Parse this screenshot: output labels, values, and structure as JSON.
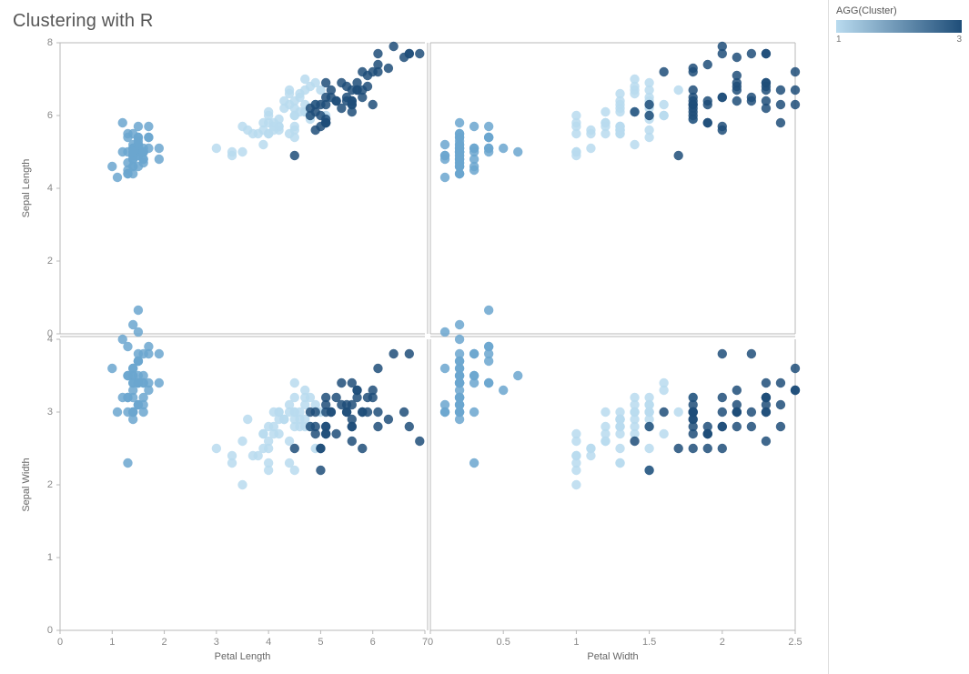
{
  "title": "Clustering with R",
  "legend": {
    "title": "AGG(Cluster)",
    "min": "1",
    "max": "3"
  },
  "chart_data": {
    "type": "scatter",
    "layout": "2x2 small multiples",
    "x_axes": [
      {
        "label": "Petal Length",
        "range": [
          0,
          7
        ],
        "ticks": [
          0,
          1,
          2,
          3,
          4,
          5,
          6,
          7
        ]
      },
      {
        "label": "Petal Width",
        "range": [
          0,
          2.5
        ],
        "ticks": [
          0.0,
          0.5,
          1.0,
          1.5,
          2.0,
          2.5
        ]
      }
    ],
    "y_axes": [
      {
        "label": "Sepal Length",
        "range": [
          0,
          8
        ],
        "ticks": [
          0,
          2,
          4,
          6,
          8
        ]
      },
      {
        "label": "Sepal Width",
        "range": [
          0,
          4
        ],
        "ticks": [
          0,
          1,
          2,
          3,
          4
        ]
      }
    ],
    "color": {
      "field": "cluster",
      "domain": [
        1,
        2,
        3
      ],
      "range": [
        "#6ba6cf",
        "#b9dbef",
        "#1f4e79"
      ]
    },
    "points": [
      {
        "pl": 1.4,
        "pw": 0.2,
        "sl": 5.1,
        "sw": 3.5,
        "c": 1
      },
      {
        "pl": 1.4,
        "pw": 0.2,
        "sl": 4.9,
        "sw": 3.0,
        "c": 1
      },
      {
        "pl": 1.3,
        "pw": 0.2,
        "sl": 4.7,
        "sw": 3.2,
        "c": 1
      },
      {
        "pl": 1.5,
        "pw": 0.2,
        "sl": 4.6,
        "sw": 3.1,
        "c": 1
      },
      {
        "pl": 1.4,
        "pw": 0.2,
        "sl": 5.0,
        "sw": 3.6,
        "c": 1
      },
      {
        "pl": 1.7,
        "pw": 0.4,
        "sl": 5.4,
        "sw": 3.9,
        "c": 1
      },
      {
        "pl": 1.4,
        "pw": 0.3,
        "sl": 4.6,
        "sw": 3.4,
        "c": 1
      },
      {
        "pl": 1.5,
        "pw": 0.2,
        "sl": 5.0,
        "sw": 3.4,
        "c": 1
      },
      {
        "pl": 1.4,
        "pw": 0.2,
        "sl": 4.4,
        "sw": 2.9,
        "c": 1
      },
      {
        "pl": 1.5,
        "pw": 0.1,
        "sl": 4.9,
        "sw": 3.1,
        "c": 1
      },
      {
        "pl": 1.5,
        "pw": 0.2,
        "sl": 5.4,
        "sw": 3.7,
        "c": 1
      },
      {
        "pl": 1.6,
        "pw": 0.2,
        "sl": 4.8,
        "sw": 3.4,
        "c": 1
      },
      {
        "pl": 1.4,
        "pw": 0.1,
        "sl": 4.8,
        "sw": 3.0,
        "c": 1
      },
      {
        "pl": 1.1,
        "pw": 0.1,
        "sl": 4.3,
        "sw": 3.0,
        "c": 1
      },
      {
        "pl": 1.2,
        "pw": 0.2,
        "sl": 5.8,
        "sw": 4.0,
        "c": 1
      },
      {
        "pl": 1.5,
        "pw": 0.4,
        "sl": 5.7,
        "sw": 4.4,
        "c": 1
      },
      {
        "pl": 1.3,
        "pw": 0.4,
        "sl": 5.4,
        "sw": 3.9,
        "c": 1
      },
      {
        "pl": 1.4,
        "pw": 0.3,
        "sl": 5.1,
        "sw": 3.5,
        "c": 1
      },
      {
        "pl": 1.7,
        "pw": 0.3,
        "sl": 5.7,
        "sw": 3.8,
        "c": 1
      },
      {
        "pl": 1.5,
        "pw": 0.3,
        "sl": 5.1,
        "sw": 3.8,
        "c": 1
      },
      {
        "pl": 1.7,
        "pw": 0.2,
        "sl": 5.4,
        "sw": 3.4,
        "c": 1
      },
      {
        "pl": 1.5,
        "pw": 0.4,
        "sl": 5.1,
        "sw": 3.7,
        "c": 1
      },
      {
        "pl": 1.0,
        "pw": 0.2,
        "sl": 4.6,
        "sw": 3.6,
        "c": 1
      },
      {
        "pl": 1.7,
        "pw": 0.5,
        "sl": 5.1,
        "sw": 3.3,
        "c": 1
      },
      {
        "pl": 1.9,
        "pw": 0.2,
        "sl": 4.8,
        "sw": 3.4,
        "c": 1
      },
      {
        "pl": 1.6,
        "pw": 0.2,
        "sl": 5.0,
        "sw": 3.0,
        "c": 1
      },
      {
        "pl": 1.6,
        "pw": 0.4,
        "sl": 5.0,
        "sw": 3.4,
        "c": 1
      },
      {
        "pl": 1.5,
        "pw": 0.2,
        "sl": 5.2,
        "sw": 3.5,
        "c": 1
      },
      {
        "pl": 1.4,
        "pw": 0.2,
        "sl": 5.2,
        "sw": 3.4,
        "c": 1
      },
      {
        "pl": 1.6,
        "pw": 0.2,
        "sl": 4.7,
        "sw": 3.2,
        "c": 1
      },
      {
        "pl": 1.6,
        "pw": 0.2,
        "sl": 4.8,
        "sw": 3.1,
        "c": 1
      },
      {
        "pl": 1.5,
        "pw": 0.4,
        "sl": 5.4,
        "sw": 3.4,
        "c": 1
      },
      {
        "pl": 1.5,
        "pw": 0.1,
        "sl": 5.2,
        "sw": 4.1,
        "c": 1
      },
      {
        "pl": 1.4,
        "pw": 0.2,
        "sl": 5.5,
        "sw": 4.2,
        "c": 1
      },
      {
        "pl": 1.5,
        "pw": 0.2,
        "sl": 4.9,
        "sw": 3.1,
        "c": 1
      },
      {
        "pl": 1.2,
        "pw": 0.2,
        "sl": 5.0,
        "sw": 3.2,
        "c": 1
      },
      {
        "pl": 1.3,
        "pw": 0.2,
        "sl": 5.5,
        "sw": 3.5,
        "c": 1
      },
      {
        "pl": 1.4,
        "pw": 0.1,
        "sl": 4.9,
        "sw": 3.6,
        "c": 1
      },
      {
        "pl": 1.3,
        "pw": 0.2,
        "sl": 4.4,
        "sw": 3.0,
        "c": 1
      },
      {
        "pl": 1.5,
        "pw": 0.2,
        "sl": 5.1,
        "sw": 3.4,
        "c": 1
      },
      {
        "pl": 1.3,
        "pw": 0.3,
        "sl": 5.0,
        "sw": 3.5,
        "c": 1
      },
      {
        "pl": 1.3,
        "pw": 0.3,
        "sl": 4.5,
        "sw": 2.3,
        "c": 1
      },
      {
        "pl": 1.3,
        "pw": 0.2,
        "sl": 4.4,
        "sw": 3.2,
        "c": 1
      },
      {
        "pl": 1.6,
        "pw": 0.6,
        "sl": 5.0,
        "sw": 3.5,
        "c": 1
      },
      {
        "pl": 1.9,
        "pw": 0.4,
        "sl": 5.1,
        "sw": 3.8,
        "c": 1
      },
      {
        "pl": 1.4,
        "pw": 0.3,
        "sl": 4.8,
        "sw": 3.0,
        "c": 1
      },
      {
        "pl": 1.6,
        "pw": 0.2,
        "sl": 5.1,
        "sw": 3.8,
        "c": 1
      },
      {
        "pl": 1.4,
        "pw": 0.2,
        "sl": 4.6,
        "sw": 3.2,
        "c": 1
      },
      {
        "pl": 1.5,
        "pw": 0.2,
        "sl": 5.3,
        "sw": 3.7,
        "c": 1
      },
      {
        "pl": 1.4,
        "pw": 0.2,
        "sl": 5.0,
        "sw": 3.3,
        "c": 1
      },
      {
        "pl": 4.7,
        "pw": 1.4,
        "sl": 7.0,
        "sw": 3.2,
        "c": 2
      },
      {
        "pl": 4.5,
        "pw": 1.5,
        "sl": 6.4,
        "sw": 3.2,
        "c": 2
      },
      {
        "pl": 4.9,
        "pw": 1.5,
        "sl": 6.9,
        "sw": 3.1,
        "c": 2
      },
      {
        "pl": 4.0,
        "pw": 1.3,
        "sl": 5.5,
        "sw": 2.3,
        "c": 2
      },
      {
        "pl": 4.6,
        "pw": 1.5,
        "sl": 6.5,
        "sw": 2.8,
        "c": 2
      },
      {
        "pl": 4.5,
        "pw": 1.3,
        "sl": 5.7,
        "sw": 2.8,
        "c": 2
      },
      {
        "pl": 4.7,
        "pw": 1.6,
        "sl": 6.3,
        "sw": 3.3,
        "c": 2
      },
      {
        "pl": 3.3,
        "pw": 1.0,
        "sl": 4.9,
        "sw": 2.4,
        "c": 2
      },
      {
        "pl": 4.6,
        "pw": 1.3,
        "sl": 6.6,
        "sw": 2.9,
        "c": 2
      },
      {
        "pl": 3.9,
        "pw": 1.4,
        "sl": 5.2,
        "sw": 2.7,
        "c": 2
      },
      {
        "pl": 3.5,
        "pw": 1.0,
        "sl": 5.0,
        "sw": 2.0,
        "c": 2
      },
      {
        "pl": 4.2,
        "pw": 1.5,
        "sl": 5.9,
        "sw": 3.0,
        "c": 2
      },
      {
        "pl": 4.0,
        "pw": 1.0,
        "sl": 6.0,
        "sw": 2.2,
        "c": 2
      },
      {
        "pl": 4.7,
        "pw": 1.4,
        "sl": 6.1,
        "sw": 2.9,
        "c": 2
      },
      {
        "pl": 3.6,
        "pw": 1.3,
        "sl": 5.6,
        "sw": 2.9,
        "c": 2
      },
      {
        "pl": 4.4,
        "pw": 1.4,
        "sl": 6.7,
        "sw": 3.1,
        "c": 2
      },
      {
        "pl": 4.5,
        "pw": 1.5,
        "sl": 5.6,
        "sw": 3.0,
        "c": 2
      },
      {
        "pl": 4.1,
        "pw": 1.0,
        "sl": 5.8,
        "sw": 2.7,
        "c": 2
      },
      {
        "pl": 4.5,
        "pw": 1.5,
        "sl": 6.2,
        "sw": 2.2,
        "c": 2
      },
      {
        "pl": 3.9,
        "pw": 1.1,
        "sl": 5.6,
        "sw": 2.5,
        "c": 2
      },
      {
        "pl": 4.8,
        "pw": 1.8,
        "sl": 5.9,
        "sw": 3.2,
        "c": 2
      },
      {
        "pl": 4.0,
        "pw": 1.3,
        "sl": 6.1,
        "sw": 2.8,
        "c": 2
      },
      {
        "pl": 4.9,
        "pw": 1.5,
        "sl": 6.3,
        "sw": 2.5,
        "c": 2
      },
      {
        "pl": 4.7,
        "pw": 1.2,
        "sl": 6.1,
        "sw": 2.8,
        "c": 2
      },
      {
        "pl": 4.3,
        "pw": 1.3,
        "sl": 6.4,
        "sw": 2.9,
        "c": 2
      },
      {
        "pl": 4.4,
        "pw": 1.4,
        "sl": 6.6,
        "sw": 3.0,
        "c": 2
      },
      {
        "pl": 4.8,
        "pw": 1.4,
        "sl": 6.8,
        "sw": 2.8,
        "c": 2
      },
      {
        "pl": 5.0,
        "pw": 1.7,
        "sl": 6.7,
        "sw": 3.0,
        "c": 2
      },
      {
        "pl": 4.5,
        "pw": 1.5,
        "sl": 6.0,
        "sw": 2.9,
        "c": 2
      },
      {
        "pl": 3.5,
        "pw": 1.0,
        "sl": 5.7,
        "sw": 2.6,
        "c": 2
      },
      {
        "pl": 3.8,
        "pw": 1.1,
        "sl": 5.5,
        "sw": 2.4,
        "c": 2
      },
      {
        "pl": 3.7,
        "pw": 1.0,
        "sl": 5.5,
        "sw": 2.4,
        "c": 2
      },
      {
        "pl": 3.9,
        "pw": 1.2,
        "sl": 5.8,
        "sw": 2.7,
        "c": 2
      },
      {
        "pl": 5.1,
        "pw": 1.6,
        "sl": 6.0,
        "sw": 2.7,
        "c": 2
      },
      {
        "pl": 4.5,
        "pw": 1.5,
        "sl": 5.4,
        "sw": 3.0,
        "c": 2
      },
      {
        "pl": 4.5,
        "pw": 1.6,
        "sl": 6.0,
        "sw": 3.4,
        "c": 2
      },
      {
        "pl": 4.7,
        "pw": 1.5,
        "sl": 6.7,
        "sw": 3.1,
        "c": 2
      },
      {
        "pl": 4.4,
        "pw": 1.3,
        "sl": 6.3,
        "sw": 2.3,
        "c": 2
      },
      {
        "pl": 4.1,
        "pw": 1.3,
        "sl": 5.6,
        "sw": 3.0,
        "c": 2
      },
      {
        "pl": 4.0,
        "pw": 1.3,
        "sl": 5.5,
        "sw": 2.5,
        "c": 2
      },
      {
        "pl": 4.4,
        "pw": 1.2,
        "sl": 5.5,
        "sw": 2.6,
        "c": 2
      },
      {
        "pl": 4.6,
        "pw": 1.4,
        "sl": 6.1,
        "sw": 3.0,
        "c": 2
      },
      {
        "pl": 4.0,
        "pw": 1.2,
        "sl": 5.8,
        "sw": 2.6,
        "c": 2
      },
      {
        "pl": 3.3,
        "pw": 1.0,
        "sl": 5.0,
        "sw": 2.3,
        "c": 2
      },
      {
        "pl": 4.2,
        "pw": 1.3,
        "sl": 5.6,
        "sw": 2.7,
        "c": 2
      },
      {
        "pl": 4.2,
        "pw": 1.2,
        "sl": 5.7,
        "sw": 3.0,
        "c": 2
      },
      {
        "pl": 4.2,
        "pw": 1.3,
        "sl": 5.7,
        "sw": 2.9,
        "c": 2
      },
      {
        "pl": 4.3,
        "pw": 1.3,
        "sl": 6.2,
        "sw": 2.9,
        "c": 2
      },
      {
        "pl": 3.0,
        "pw": 1.1,
        "sl": 5.1,
        "sw": 2.5,
        "c": 2
      },
      {
        "pl": 4.1,
        "pw": 1.3,
        "sl": 5.7,
        "sw": 2.8,
        "c": 2
      },
      {
        "pl": 6.0,
        "pw": 2.5,
        "sl": 6.3,
        "sw": 3.3,
        "c": 3
      },
      {
        "pl": 5.1,
        "pw": 1.9,
        "sl": 5.8,
        "sw": 2.7,
        "c": 3
      },
      {
        "pl": 5.9,
        "pw": 2.1,
        "sl": 7.1,
        "sw": 3.0,
        "c": 3
      },
      {
        "pl": 5.6,
        "pw": 1.8,
        "sl": 6.3,
        "sw": 2.9,
        "c": 3
      },
      {
        "pl": 5.8,
        "pw": 2.2,
        "sl": 6.5,
        "sw": 3.0,
        "c": 3
      },
      {
        "pl": 6.6,
        "pw": 2.1,
        "sl": 7.6,
        "sw": 3.0,
        "c": 3
      },
      {
        "pl": 4.5,
        "pw": 1.7,
        "sl": 4.9,
        "sw": 2.5,
        "c": 3
      },
      {
        "pl": 6.3,
        "pw": 1.8,
        "sl": 7.3,
        "sw": 2.9,
        "c": 3
      },
      {
        "pl": 5.8,
        "pw": 1.8,
        "sl": 6.7,
        "sw": 2.5,
        "c": 3
      },
      {
        "pl": 6.1,
        "pw": 2.5,
        "sl": 7.2,
        "sw": 3.6,
        "c": 3
      },
      {
        "pl": 5.1,
        "pw": 2.0,
        "sl": 6.5,
        "sw": 3.2,
        "c": 3
      },
      {
        "pl": 5.3,
        "pw": 1.9,
        "sl": 6.4,
        "sw": 2.7,
        "c": 3
      },
      {
        "pl": 5.5,
        "pw": 2.1,
        "sl": 6.8,
        "sw": 3.0,
        "c": 3
      },
      {
        "pl": 5.0,
        "pw": 2.0,
        "sl": 5.7,
        "sw": 2.5,
        "c": 3
      },
      {
        "pl": 5.1,
        "pw": 2.4,
        "sl": 5.8,
        "sw": 2.8,
        "c": 3
      },
      {
        "pl": 5.3,
        "pw": 2.3,
        "sl": 6.4,
        "sw": 3.2,
        "c": 3
      },
      {
        "pl": 5.5,
        "pw": 1.8,
        "sl": 6.5,
        "sw": 3.0,
        "c": 3
      },
      {
        "pl": 6.7,
        "pw": 2.2,
        "sl": 7.7,
        "sw": 3.8,
        "c": 3
      },
      {
        "pl": 6.9,
        "pw": 2.3,
        "sl": 7.7,
        "sw": 2.6,
        "c": 3
      },
      {
        "pl": 5.0,
        "pw": 1.5,
        "sl": 6.0,
        "sw": 2.2,
        "c": 3
      },
      {
        "pl": 5.7,
        "pw": 2.3,
        "sl": 6.9,
        "sw": 3.2,
        "c": 3
      },
      {
        "pl": 4.9,
        "pw": 2.0,
        "sl": 5.6,
        "sw": 2.8,
        "c": 3
      },
      {
        "pl": 6.7,
        "pw": 2.0,
        "sl": 7.7,
        "sw": 2.8,
        "c": 3
      },
      {
        "pl": 4.9,
        "pw": 1.8,
        "sl": 6.3,
        "sw": 2.7,
        "c": 3
      },
      {
        "pl": 5.7,
        "pw": 2.1,
        "sl": 6.7,
        "sw": 3.3,
        "c": 3
      },
      {
        "pl": 6.0,
        "pw": 1.8,
        "sl": 7.2,
        "sw": 3.2,
        "c": 3
      },
      {
        "pl": 4.8,
        "pw": 1.8,
        "sl": 6.2,
        "sw": 2.8,
        "c": 3
      },
      {
        "pl": 4.9,
        "pw": 1.8,
        "sl": 6.1,
        "sw": 3.0,
        "c": 3
      },
      {
        "pl": 5.6,
        "pw": 2.1,
        "sl": 6.4,
        "sw": 2.8,
        "c": 3
      },
      {
        "pl": 5.8,
        "pw": 1.6,
        "sl": 7.2,
        "sw": 3.0,
        "c": 3
      },
      {
        "pl": 6.1,
        "pw": 1.9,
        "sl": 7.4,
        "sw": 2.8,
        "c": 3
      },
      {
        "pl": 6.4,
        "pw": 2.0,
        "sl": 7.9,
        "sw": 3.8,
        "c": 3
      },
      {
        "pl": 5.6,
        "pw": 2.2,
        "sl": 6.4,
        "sw": 2.8,
        "c": 3
      },
      {
        "pl": 5.1,
        "pw": 1.5,
        "sl": 6.3,
        "sw": 2.8,
        "c": 3
      },
      {
        "pl": 5.6,
        "pw": 1.4,
        "sl": 6.1,
        "sw": 2.6,
        "c": 3
      },
      {
        "pl": 6.1,
        "pw": 2.3,
        "sl": 7.7,
        "sw": 3.0,
        "c": 3
      },
      {
        "pl": 5.6,
        "pw": 2.4,
        "sl": 6.3,
        "sw": 3.4,
        "c": 3
      },
      {
        "pl": 5.5,
        "pw": 1.8,
        "sl": 6.4,
        "sw": 3.1,
        "c": 3
      },
      {
        "pl": 4.8,
        "pw": 1.8,
        "sl": 6.0,
        "sw": 3.0,
        "c": 3
      },
      {
        "pl": 5.4,
        "pw": 2.1,
        "sl": 6.9,
        "sw": 3.1,
        "c": 3
      },
      {
        "pl": 5.6,
        "pw": 2.4,
        "sl": 6.7,
        "sw": 3.1,
        "c": 3
      },
      {
        "pl": 5.1,
        "pw": 2.3,
        "sl": 6.9,
        "sw": 3.1,
        "c": 3
      },
      {
        "pl": 5.1,
        "pw": 1.9,
        "sl": 5.8,
        "sw": 2.7,
        "c": 3
      },
      {
        "pl": 5.9,
        "pw": 2.3,
        "sl": 6.8,
        "sw": 3.2,
        "c": 3
      },
      {
        "pl": 5.7,
        "pw": 2.5,
        "sl": 6.7,
        "sw": 3.3,
        "c": 3
      },
      {
        "pl": 5.2,
        "pw": 2.3,
        "sl": 6.7,
        "sw": 3.0,
        "c": 3
      },
      {
        "pl": 5.0,
        "pw": 1.9,
        "sl": 6.3,
        "sw": 2.5,
        "c": 3
      },
      {
        "pl": 5.2,
        "pw": 2.0,
        "sl": 6.5,
        "sw": 3.0,
        "c": 3
      },
      {
        "pl": 5.4,
        "pw": 2.3,
        "sl": 6.2,
        "sw": 3.4,
        "c": 3
      },
      {
        "pl": 5.1,
        "pw": 1.8,
        "sl": 5.9,
        "sw": 3.0,
        "c": 3
      }
    ]
  }
}
